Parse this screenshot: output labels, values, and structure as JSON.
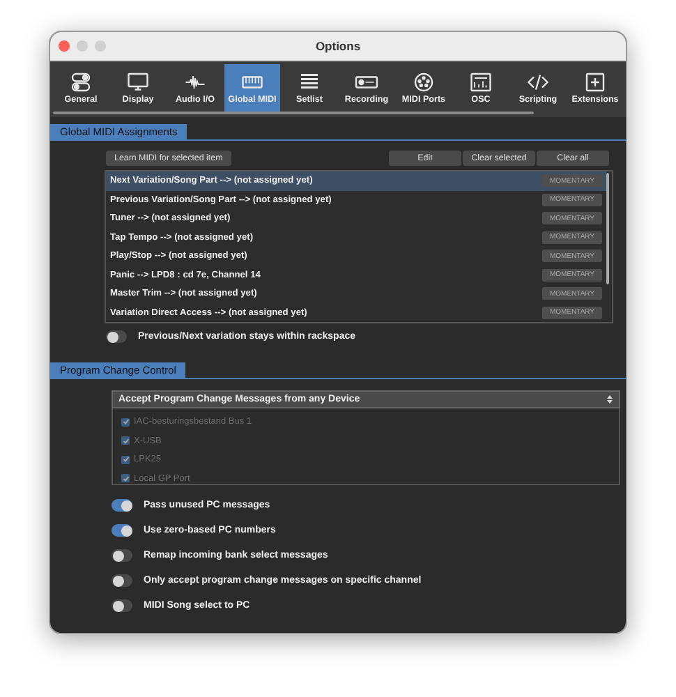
{
  "window": {
    "title": "Options"
  },
  "toolbar": [
    {
      "kind": "general",
      "label": "General",
      "selected": false
    },
    {
      "kind": "display",
      "label": "Display",
      "selected": false
    },
    {
      "kind": "audio",
      "label": "Audio I/O",
      "selected": false
    },
    {
      "kind": "midi",
      "label": "Global MIDI",
      "selected": true
    },
    {
      "kind": "setlist",
      "label": "Setlist",
      "selected": false
    },
    {
      "kind": "recording",
      "label": "Recording",
      "selected": false
    },
    {
      "kind": "ports",
      "label": "MIDI Ports",
      "selected": false
    },
    {
      "kind": "osc",
      "label": "OSC",
      "selected": false
    },
    {
      "kind": "scripting",
      "label": "Scripting",
      "selected": false
    },
    {
      "kind": "extensions",
      "label": "Extensions",
      "selected": false
    }
  ],
  "global_midi": {
    "title": "Global MIDI Assignments",
    "learn_button": "Learn MIDI for selected item",
    "buttons": [
      "Edit",
      "Clear selected",
      "Clear all"
    ],
    "assignments": [
      {
        "text": "Next Variation/Song Part --> (not assigned yet)",
        "mode": "MOMENTARY",
        "selected": true
      },
      {
        "text": "Previous Variation/Song Part --> (not assigned yet)",
        "mode": "MOMENTARY",
        "selected": false
      },
      {
        "text": "Tuner --> (not assigned yet)",
        "mode": "MOMENTARY",
        "selected": false
      },
      {
        "text": "Tap Tempo --> (not assigned yet)",
        "mode": "MOMENTARY",
        "selected": false
      },
      {
        "text": "Play/Stop --> (not assigned yet)",
        "mode": "MOMENTARY",
        "selected": false
      },
      {
        "text": "Panic --> LPD8 : cd 7e, Channel 14",
        "mode": "MOMENTARY",
        "selected": false
      },
      {
        "text": "Master Trim --> (not assigned yet)",
        "mode": "MOMENTARY",
        "selected": false
      },
      {
        "text": "Variation Direct Access --> (not assigned yet)",
        "mode": "MOMENTARY",
        "selected": false
      }
    ],
    "toggle": {
      "label": "Previous/Next variation stays within rackspace",
      "on": false
    }
  },
  "program_change": {
    "title": "Program Change Control",
    "dropdown": {
      "value": "Accept Program Change Messages from any Device"
    },
    "devices": [
      {
        "name": "IAC-besturingsbestand Bus 1",
        "checked": true,
        "disabled": true
      },
      {
        "name": "X-USB",
        "checked": true,
        "disabled": true
      },
      {
        "name": "LPK25",
        "checked": true,
        "disabled": true
      },
      {
        "name": "Local GP Port",
        "checked": true,
        "disabled": true
      }
    ],
    "options": [
      {
        "label": "Pass unused PC messages",
        "on": true
      },
      {
        "label": "Use zero-based PC numbers",
        "on": true
      },
      {
        "label": "Remap incoming bank select messages",
        "on": false
      },
      {
        "label": "Only accept program change messages on specific channel",
        "on": false
      },
      {
        "label": "MIDI Song select to PC",
        "on": false
      }
    ]
  }
}
